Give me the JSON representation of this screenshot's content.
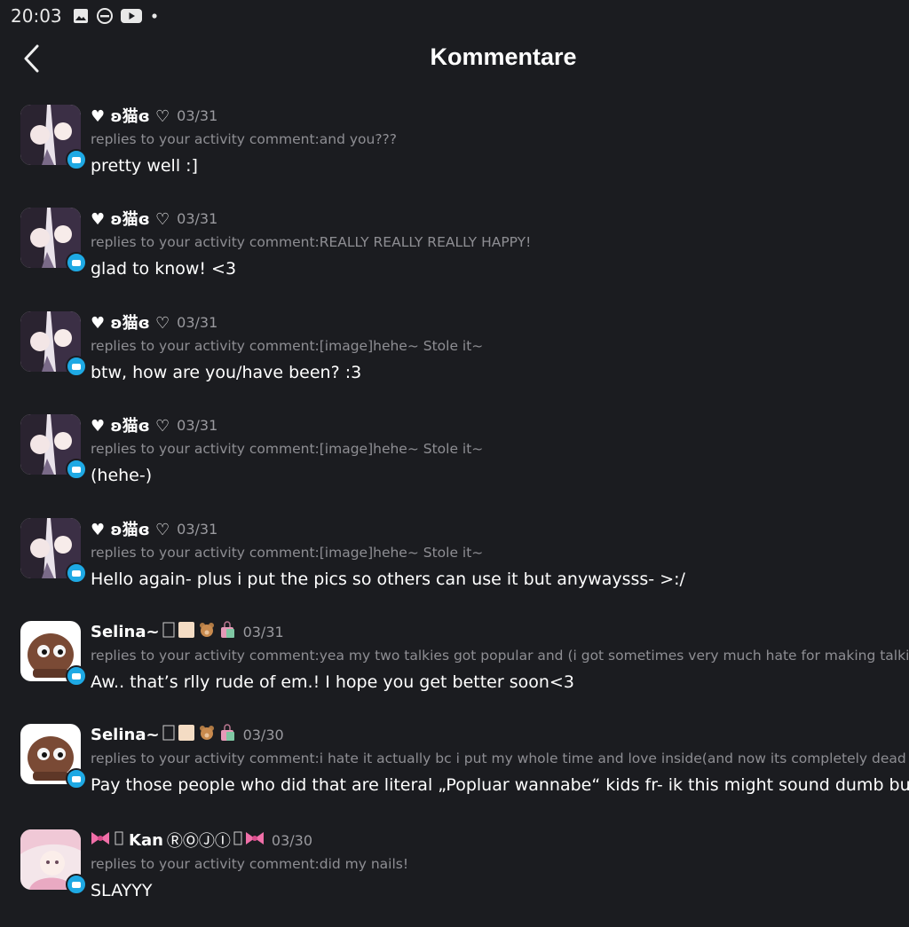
{
  "status_bar": {
    "time": "20:03",
    "icons": [
      "image-icon",
      "do-not-disturb-icon",
      "youtube-icon",
      "dot-icon"
    ]
  },
  "header": {
    "title": "Kommentare",
    "back_icon": "chevron-left-icon"
  },
  "colors": {
    "background": "#1b1c20",
    "accent": "#1ea9e4",
    "muted": "#8e8e93"
  },
  "comments": [
    {
      "name": "♥ ʚ猫ɞ ♡",
      "date": "03/31",
      "reply": "replies to your activity comment:and you???",
      "text": "pretty well :]",
      "avatar": "anime-duo"
    },
    {
      "name": "♥ ʚ猫ɞ ♡",
      "date": "03/31",
      "reply": "replies to your activity comment:REALLY REALLY REALLY HAPPY!",
      "text": "glad to know! <3",
      "avatar": "anime-duo"
    },
    {
      "name": "♥ ʚ猫ɞ ♡",
      "date": "03/31",
      "reply": "replies to your activity comment:[image]hehe~ Stole it~",
      "text": "btw, how are you/have been? :3",
      "avatar": "anime-duo"
    },
    {
      "name": "♥ ʚ猫ɞ ♡",
      "date": "03/31",
      "reply": "replies to your activity comment:[image]hehe~ Stole it~",
      "text": "(hehe-)",
      "avatar": "anime-duo"
    },
    {
      "name": "♥ ʚ猫ɞ ♡",
      "date": "03/31",
      "reply": "replies to your activity comment:[image]hehe~ Stole it~",
      "text": "Hello again- plus i put the pics so others can use it but anywaysss-   >:/",
      "avatar": "anime-duo"
    },
    {
      "name": "Selina~",
      "date": "03/31",
      "reply": "replies to your activity comment:yea my two talkies got popular and (i got sometimes very much hate for making talkies wro",
      "text": "Aw.. that’s rlly rude of em.! I hope you get better soon<3",
      "avatar": "brown-creature",
      "emoji": "bear-bag"
    },
    {
      "name": "Selina~",
      "date": "03/30",
      "reply": "replies to your activity comment:i hate it actually bc i put my whole time and love inside(and now its completely dead and ha",
      "text": "Pay those people who did that are literal „Popluar wannabe“ kids fr- ik this might sound dumb but like I sa",
      "avatar": "brown-creature",
      "emoji": "bear-bag"
    },
    {
      "name": "Kan",
      "name_suffix": "ⓇⓄⒿⒾ",
      "date": "03/30",
      "reply": "replies to your activity comment:did my nails!",
      "text": "SLAYYY",
      "avatar": "pink-anime",
      "emoji": "bows"
    }
  ]
}
